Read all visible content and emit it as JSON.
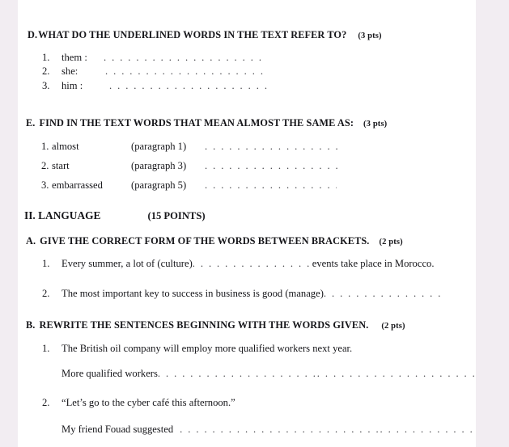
{
  "page": {
    "background_color": "#f2edf2",
    "paper_color": "#ffffff"
  },
  "sections": {
    "d": {
      "label": "D.",
      "title": "WHAT DO THE UNDERLINED WORDS IN THE TEXT REFER TO?",
      "points": "(3 pts)",
      "items": [
        {
          "number": "1.",
          "word": "them :",
          "leader": ". . . . . . . .  . . . . . . . . . . . . . . ."
        },
        {
          "number": "2.",
          "word": "she:",
          "leader": ". . . . . . . .  . . . . . . . . . . . . . . ."
        },
        {
          "number": "3.",
          "word": "him :",
          "leader": ". . . . . . . .  . . . . . . . . . . . . . ."
        }
      ]
    },
    "e": {
      "label": "E.",
      "title": "FIND IN THE TEXT WORDS THAT MEAN ALMOST THE SAME AS:",
      "points": "(3 pts)",
      "items": [
        {
          "number": "1.",
          "word": "almost",
          "paragraph": "(paragraph 1)",
          "leader": ". . . . . . . .  . . . . . . . . . . . . .  . . ."
        },
        {
          "number": "2.",
          "word": "start",
          "paragraph": "(paragraph 3)",
          "leader": ". . . . . . . .  . . . . . . . . . . . . .  . . ."
        },
        {
          "number": "3.",
          "word": "embarrassed",
          "paragraph": "(paragraph 5)",
          "leader": ". . . . . . . .  . . . . . . . . . . . . . . ."
        }
      ]
    },
    "language": {
      "label": "II. LANGUAGE",
      "points": "(15 POINTS)"
    },
    "a": {
      "label": "A.",
      "title": "GIVE THE CORRECT FORM OF THE WORDS BETWEEN BRACKETS.",
      "points": "(2 pts)",
      "items": [
        {
          "number": "1.",
          "prompt": "Every summer, a lot of (culture)",
          "leader": ". . . . . . . .  . . . . . . . . . . . . .  . . .",
          "tail": "events take place in Morocco."
        },
        {
          "number": "2.",
          "prompt": "The most important key to success in business is good (manage)",
          "leader": ". . . . . . . .  . . . . . . . . . . . . . .",
          "tail": ""
        }
      ]
    },
    "b": {
      "label": "B.",
      "title": "REWRITE THE SENTENCES BEGINNING WITH THE WORDS GIVEN.",
      "points": "(2 pts)",
      "items": [
        {
          "number": "1.",
          "sentence": "The British oil company will employ more qualified workers next year.",
          "answer_start": "More qualified workers",
          "answer_leader": ". . . . . . . .  . . . . . . . . . . . ..  . . . . . . . . . . . .  . . . . . . . . . . . ..  . . . . . . . . . . . . ."
        },
        {
          "number": "2.",
          "sentence": "“Let’s go to the cyber café this afternoon.”",
          "answer_start": "My friend Fouad suggested",
          "answer_leader": ". . . . . . . .  . . . . . . . . . . . . . . . . ..  . . . . . . . . . . . . . . . . . . . . . ..  . . . ."
        }
      ]
    }
  }
}
